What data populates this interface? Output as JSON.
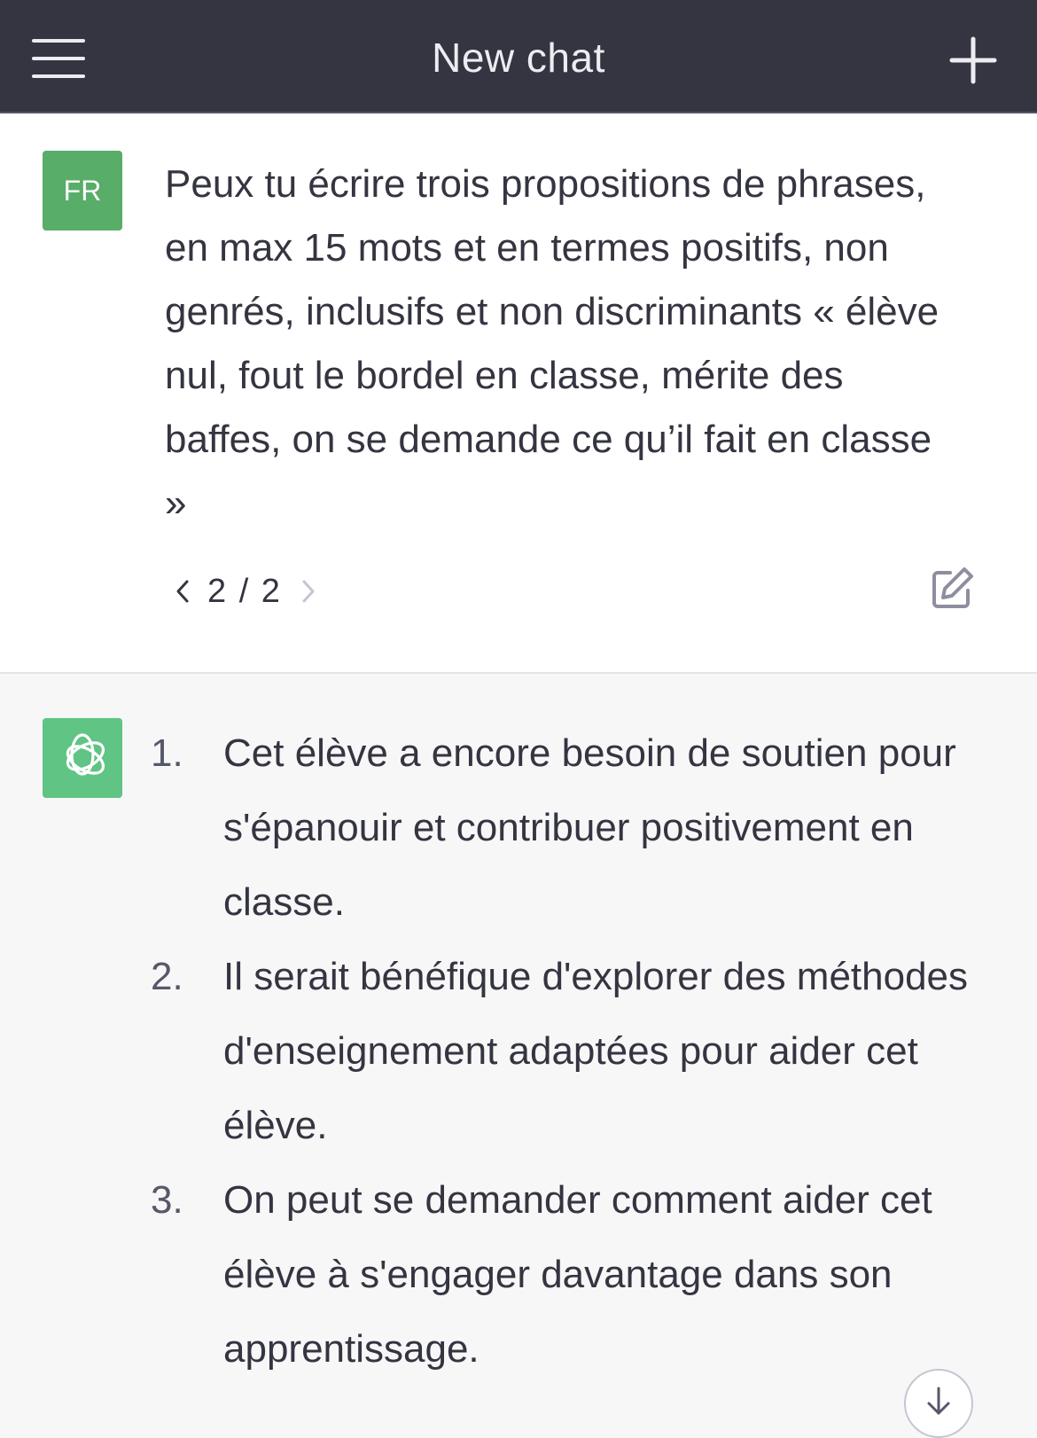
{
  "header": {
    "title": "New chat",
    "menu_icon": "hamburger-menu-icon",
    "new_chat_icon": "plus-icon"
  },
  "user_message": {
    "avatar_initials": "FR",
    "avatar_color": "#58ad68",
    "text": "Peux tu écrire trois propositions de phrases, en max 15 mots et en termes positifs, non genrés, inclusifs et non discriminants « élève nul, fout le bordel en classe, mérite des baffes, on se demande ce qu’il fait en classe »",
    "pager": {
      "current_total": "2 / 2",
      "prev_icon": "chevron-left-icon",
      "next_icon": "chevron-right-icon"
    },
    "edit_icon": "edit-icon"
  },
  "assistant_message": {
    "avatar_icon": "openai-logo-icon",
    "avatar_color": "#5fc484",
    "items": [
      {
        "number": "1.",
        "text": "Cet élève a encore besoin de soutien pour s'épanouir et contribuer positivement en classe."
      },
      {
        "number": "2.",
        "text": "Il serait bénéfique d'explorer des méthodes d'enseignement adaptées pour aider cet élève."
      },
      {
        "number": "3.",
        "text": "On peut se demander comment aider cet élève à s'engager davantage dans son apprentissage."
      }
    ]
  },
  "scroll_down_icon": "arrow-down-icon",
  "colors": {
    "header_bg": "#343541",
    "user_bg": "#ffffff",
    "assistant_bg": "#f7f7f8"
  }
}
